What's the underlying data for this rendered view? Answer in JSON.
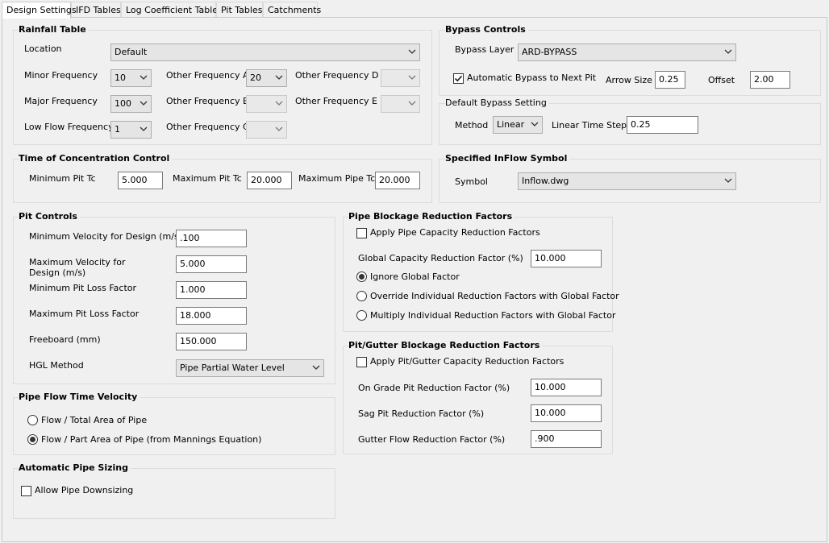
{
  "tabs": [
    "Design Settings",
    "IFD Tables",
    "Log Coefficient Tables",
    "Pit Tables",
    "Catchments"
  ],
  "rainfall": {
    "title": "Rainfall Table",
    "location_label": "Location",
    "location_value": "Default",
    "minor_label": "Minor Frequency",
    "minor_value": "10",
    "major_label": "Major Frequency",
    "major_value": "100",
    "low_label": "Low Flow Frequency",
    "low_value": "1",
    "other_a_label": "Other Frequency A",
    "other_a_value": "20",
    "other_b_label": "Other Frequency B",
    "other_c_label": "Other Frequency C",
    "other_d_label": "Other Frequency D",
    "other_e_label": "Other Frequency E"
  },
  "bypass": {
    "title": "Bypass Controls",
    "layer_label": "Bypass Layer",
    "layer_value": "ARD-BYPASS",
    "auto_label": "Automatic Bypass to Next Pit",
    "auto_checked": true,
    "arrow_label": "Arrow Size",
    "arrow_value": "0.25",
    "offset_label": "Offset",
    "offset_value": "2.00"
  },
  "default_bypass": {
    "title": "Default Bypass Setting",
    "method_label": "Method",
    "method_value": "Linear",
    "step_label": "Linear Time Step",
    "step_value": "0.25"
  },
  "toc": {
    "title": "Time of Concentration Control",
    "min_pit_label": "Minimum Pit Tc",
    "min_pit_value": "5.000",
    "max_pit_label": "Maximum Pit Tc",
    "max_pit_value": "20.000",
    "max_pipe_label": "Maximum Pipe Tc",
    "max_pipe_value": "20.000"
  },
  "inflow": {
    "title": "Specified InFlow Symbol",
    "symbol_label": "Symbol",
    "symbol_value": "Inflow.dwg"
  },
  "pit_controls": {
    "title": "Pit Controls",
    "min_vel_label": "Minimum Velocity for Design (m/s)",
    "min_vel_value": ".100",
    "max_vel_label": "Maximum Velocity for Design (m/s)",
    "max_vel_value": "5.000",
    "min_loss_label": "Minimum Pit Loss Factor",
    "min_loss_value": "1.000",
    "max_loss_label": "Maximum Pit Loss Factor",
    "max_loss_value": "18.000",
    "freeboard_label": "Freeboard (mm)",
    "freeboard_value": "150.000",
    "hgl_label": "HGL Method",
    "hgl_value": "Pipe Partial Water Level"
  },
  "pipe_flow": {
    "title": "Pipe Flow Time Velocity",
    "opt1": "Flow / Total Area of Pipe",
    "opt2": "Flow / Part Area of Pipe (from Mannings Equation)",
    "selected": 2
  },
  "auto_sizing": {
    "title": "Automatic Pipe Sizing",
    "downsizing_label": "Allow Pipe Downsizing",
    "downsizing_checked": false
  },
  "pipe_blockage": {
    "title": "Pipe Blockage Reduction Factors",
    "apply_label": "Apply Pipe Capacity Reduction Factors",
    "apply_checked": false,
    "global_label": "Global Capacity Reduction Factor (%)",
    "global_value": "10.000",
    "opt1": "Ignore Global Factor",
    "opt2": "Override Individual Reduction Factors with Global Factor",
    "opt3": "Multiply Individual Reduction Factors with Global Factor",
    "selected": 1
  },
  "pit_blockage": {
    "title": "Pit/Gutter Blockage Reduction Factors",
    "apply_label": "Apply Pit/Gutter Capacity Reduction Factors",
    "apply_checked": false,
    "ongrade_label": "On Grade Pit Reduction Factor (%)",
    "ongrade_value": "10.000",
    "sag_label": "Sag Pit Reduction Factor (%)",
    "sag_value": "10.000",
    "gutter_label": "Gutter Flow Reduction Factor (%)",
    "gutter_value": ".900"
  },
  "icons": {
    "dropdown": "chevron-down-icon",
    "check": "checkmark-icon",
    "radio": "radio-dot-icon"
  }
}
